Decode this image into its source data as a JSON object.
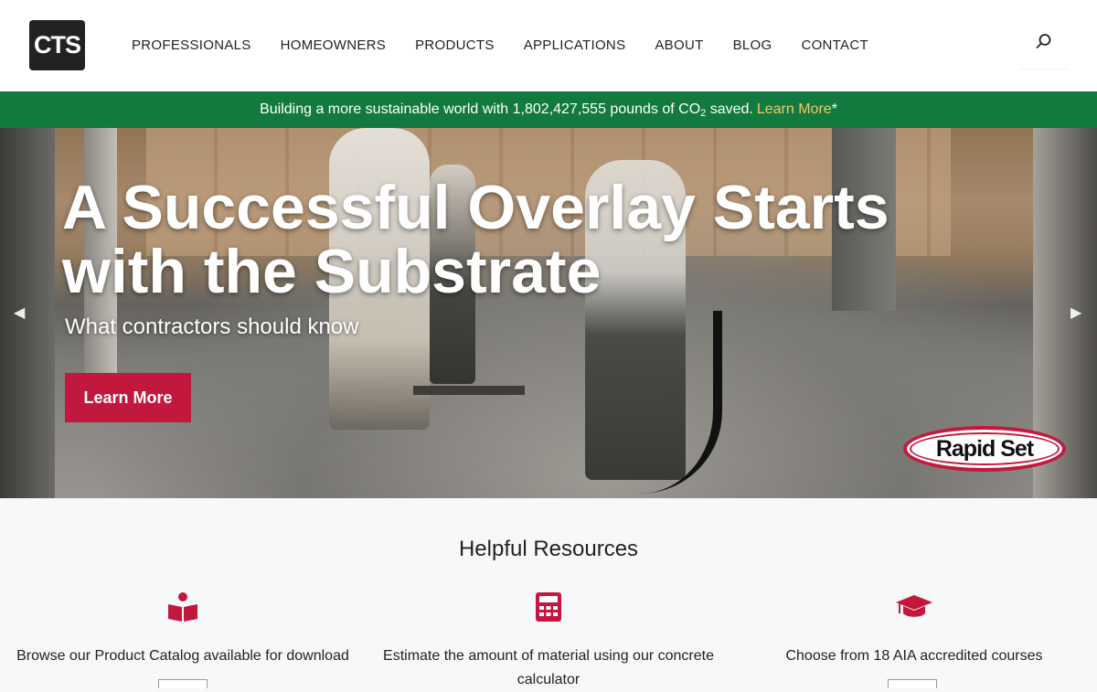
{
  "header": {
    "logo_text": "CTS",
    "nav": [
      "PROFESSIONALS",
      "HOMEOWNERS",
      "PRODUCTS",
      "APPLICATIONS",
      "ABOUT",
      "BLOG",
      "CONTACT"
    ],
    "search_icon": "search-icon"
  },
  "banner": {
    "text_before": "Building a more sustainable world with 1,802,427,555 pounds of CO",
    "subscript": "2",
    "text_after": " saved.",
    "link": "Learn More",
    "asterisk": "*",
    "colors": {
      "background": "#127a3e",
      "link": "#f1c96c"
    }
  },
  "hero": {
    "title": "A Successful Overlay Starts with the Substrate",
    "subtitle": "What contractors should know",
    "button": "Learn More",
    "badge": "Rapid Set",
    "prev_icon": "◀",
    "next_icon": "▶",
    "colors": {
      "button": "#c3183e"
    }
  },
  "resources": {
    "title": "Helpful Resources",
    "items": [
      {
        "icon": "book-reader-icon",
        "text": "Browse our Product Catalog available for download"
      },
      {
        "icon": "calculator-icon",
        "text": "Estimate the amount of material using our concrete calculator"
      },
      {
        "icon": "graduation-cap-icon",
        "text": "Choose from 18 AIA accredited courses"
      }
    ],
    "colors": {
      "icon": "#c3183e"
    }
  }
}
